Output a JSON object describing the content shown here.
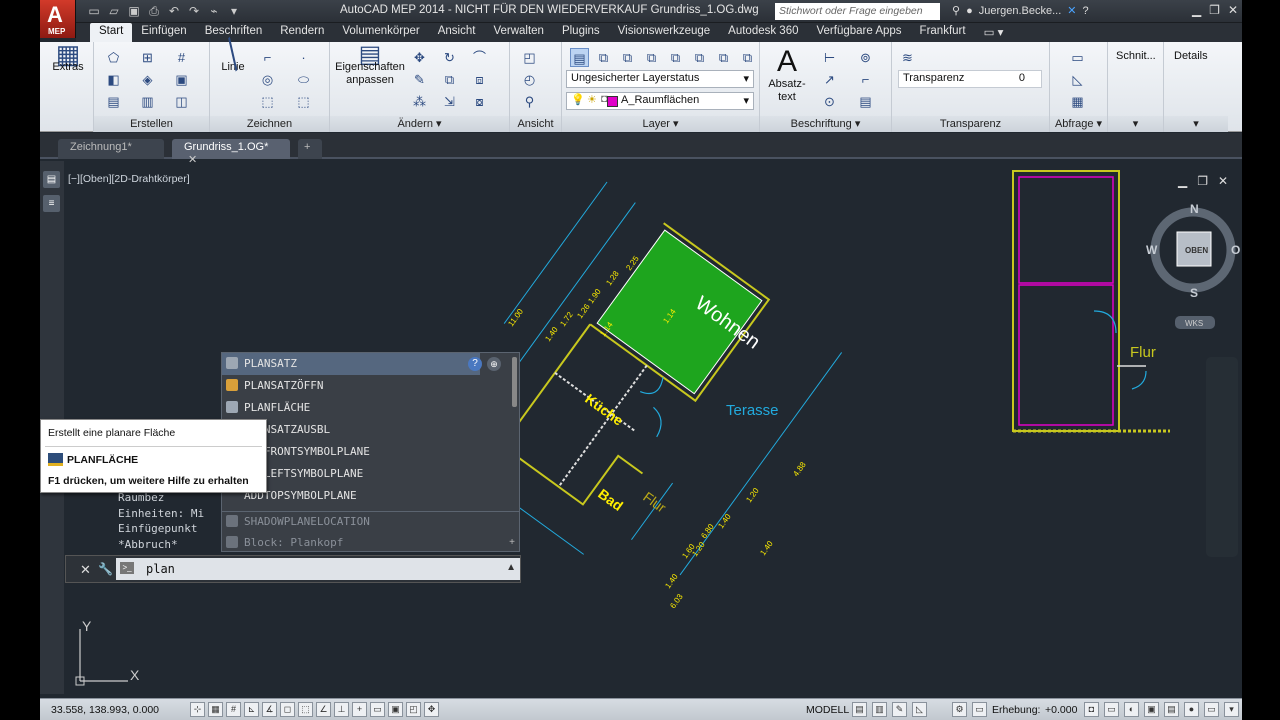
{
  "app": {
    "logo_letter": "A",
    "logo_sub": "MEP",
    "title": "AutoCAD MEP 2014 - NICHT FÜR DEN WIEDERVERKAUF   Grundriss_1.OG.dwg",
    "search_placeholder": "Stichwort oder Frage eingeben",
    "user": "Juergen.Becke..."
  },
  "ribbon_tabs": [
    "Start",
    "Einfügen",
    "Beschriften",
    "Rendern",
    "Volumenkörper",
    "Ansicht",
    "Verwalten",
    "Plugins",
    "Visionswerkzeuge",
    "Autodesk 360",
    "Verfügbare Apps",
    "Frankfurt"
  ],
  "ribbon": {
    "extras_label": "Extras",
    "erstellen_label": "Erstellen",
    "linie_label": "Linie",
    "zeichnen_label": "Zeichnen",
    "eigenschaften_label": "Eigenschaften anpassen",
    "aendern_label": "Ändern ▾",
    "ansicht_label": "Ansicht",
    "layer_status": "Ungesicherter Layerstatus",
    "layer_current": "A_Raumflächen",
    "layer_label": "Layer ▾",
    "absatztext_label": "Absatz-text",
    "beschriftung_label": "Beschriftung ▾",
    "transparenz_field": "Transparenz",
    "transparenz_value": "0",
    "transparenz_label": "Transparenz",
    "abfrage_label": "Abfrage ▾",
    "schnitt_label": "Schnit...",
    "details_label": "Details",
    "layer_color": "#e000c8"
  },
  "doc_tabs": [
    "Zeichnung1*",
    "Grundriss_1.OG*"
  ],
  "viewport": {
    "label": "[−][Oben][2D-Drahtkörper]",
    "viewcube_top": "OBEN",
    "compass": {
      "n": "N",
      "s": "S",
      "w": "W",
      "o": "O"
    },
    "wks": "WKS",
    "ucs_x": "X",
    "ucs_y": "Y"
  },
  "drawing": {
    "rooms": {
      "wohnen": "Wohnen",
      "kueche": "Küche",
      "bad": "Bad",
      "flur": "Flur",
      "terasse": "Terasse",
      "flur_right": "Flur"
    },
    "dims_top": [
      "11.00",
      "1.40",
      "1.26",
      "1.90",
      "1.28",
      "2.25",
      "1.14",
      "1.72",
      "1.14"
    ],
    "dims_right": [
      "4.88",
      "1.20",
      "1.40",
      "1.20",
      "1.40"
    ],
    "dims_bottom": [
      "1.40",
      "1.60",
      "6.80",
      "6.03"
    ],
    "green_fill": "#1ea51e",
    "wall_color": "#c8c81e"
  },
  "autocomplete": {
    "items": [
      "PLANSATZ",
      "PLANSATZÖFFN",
      "PLANFLÄCHE",
      "PLANSATZAUSBL",
      "ADDFRONTSYMBOLPLANE",
      "ADDLEFTSYMBOLPLANE",
      "ADDTOPSYMBOLPLANE",
      "SHADOWPLANELOCATION",
      "Block: Plankopf"
    ]
  },
  "tooltip": {
    "desc": "Erstellt eine planare Fläche",
    "command": "PLANFLÄCHE",
    "help": "F1 drücken, um weitere Hilfe zu erhalten"
  },
  "command_history": [
    "Raumbez",
    "Einheiten: Mi",
    "Einfügepunkt",
    "*Abbruch*"
  ],
  "command_input": "plan",
  "status": {
    "coords": "33.558, 138.993, 0.000",
    "modell": "MODELL",
    "erhebung": "Erhebung:",
    "erhebung_value": "+0.000"
  }
}
